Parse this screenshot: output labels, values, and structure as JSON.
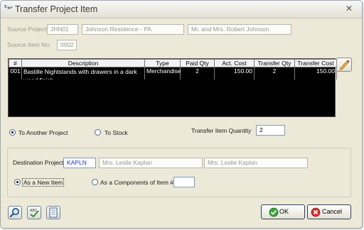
{
  "window": {
    "title": "Transfer Project Item"
  },
  "source": {
    "project_label": "Source Project",
    "project_code": "JHN01",
    "project_name": "Johnson Residence - PA",
    "project_client": "Mr. and Mrs. Robert Johnson",
    "item_no_label": "Source Item No.",
    "item_no": "0002"
  },
  "grid": {
    "headers": [
      "#",
      "Description",
      "Type",
      "Paid Qty",
      "Act. Cost",
      "Transfer Qty",
      "Transfer Cost"
    ],
    "rows": [
      {
        "num": "001",
        "description_line1": "Bastille Nightstands with drawers in a dark",
        "description_line2": "wood finish",
        "type": "Merchandise",
        "paid_qty": "2",
        "act_cost": "150.00",
        "transfer_qty": "2",
        "transfer_cost": "150.00"
      }
    ]
  },
  "transfer_target": {
    "option_project": "To Another Project",
    "option_stock": "To Stock",
    "selected": "To Another Project",
    "qty_label": "Transfer Item Quantity",
    "qty_value": "2"
  },
  "destination": {
    "label": "Destination Project",
    "code": "KAPLN",
    "name": "Mrs. Leslie Kaplan",
    "client": "Mrs. Leslie Kaplan",
    "option_new": "As a New Item",
    "option_component": "As a Components of Item #",
    "selected": "As a New Item",
    "component_item_value": ""
  },
  "buttons": {
    "ok": "OK",
    "cancel": "Cancel"
  },
  "colors": {
    "window_bg": "#ece9d8",
    "grid_bg": "#000000",
    "dest_code": "#1a33c8",
    "cancel_icon": "#d42020",
    "ok_icon": "#2e8b2e"
  }
}
